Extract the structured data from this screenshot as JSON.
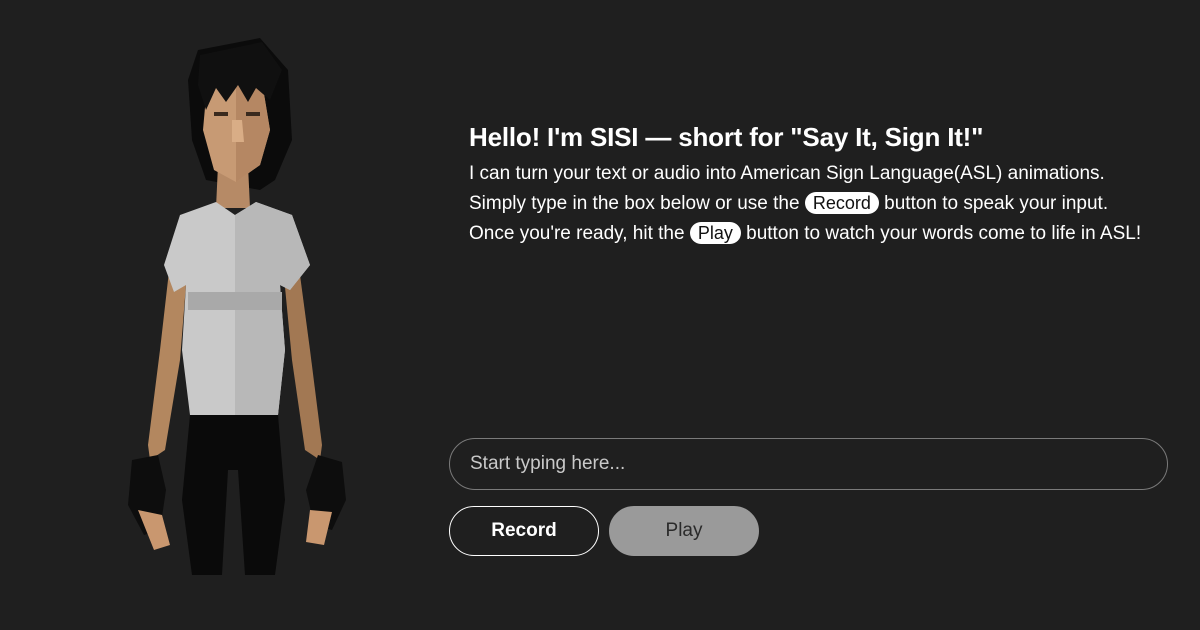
{
  "intro": {
    "greeting_pre": "Hello! I'm ",
    "name": "SISI",
    "greeting_post": " — short for \"Say It, Sign It!\"",
    "desc_part1": "I can turn your text or audio into American Sign Language(ASL) animations. Simply type in the box below or use the ",
    "record_chip": "Record",
    "desc_part2": " button to speak your input. Once you're ready, hit the ",
    "play_chip": "Play",
    "desc_part3": " button to watch your words come to life in ASL!"
  },
  "input": {
    "placeholder": "Start typing here...",
    "value": ""
  },
  "buttons": {
    "record_label": "Record",
    "play_label": "Play"
  },
  "colors": {
    "background": "#1f1f1f",
    "text": "#ffffff",
    "play_button": "#9a9a9a"
  }
}
